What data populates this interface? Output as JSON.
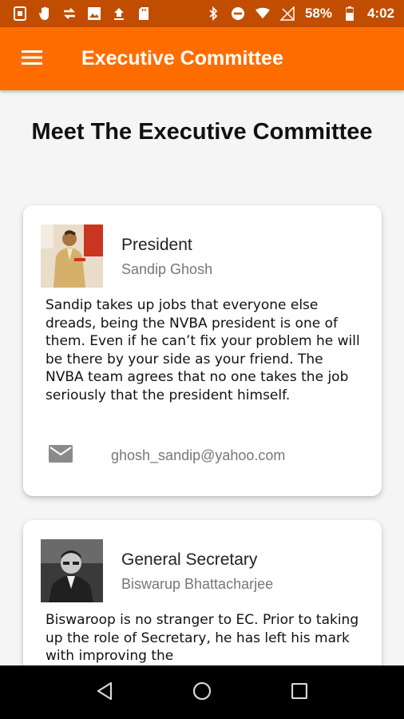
{
  "status_bar": {
    "battery_percent": "58%",
    "time": "4:02",
    "icons": [
      "phone-sync-icon",
      "hand-icon",
      "transfer-icon",
      "image-icon",
      "upload-icon",
      "sd-card-icon",
      "bluetooth-icon",
      "do-not-disturb-icon",
      "wifi-icon",
      "no-signal-icon",
      "battery-icon"
    ]
  },
  "app_bar": {
    "title": "Executive Committee",
    "menu_icon": "hamburger-menu-icon",
    "color": "#ff6d00"
  },
  "page": {
    "heading": "Meet The Executive Committee"
  },
  "members": [
    {
      "role": "President",
      "name": "Sandip Ghosh",
      "bio": "Sandip takes up jobs that everyone else dreads, being the NVBA president is one of them. Even if he can’t fix your problem he will be there by your side as your friend. The NVBA team agrees that no one takes the job seriously that the president himself.",
      "email": "ghosh_sandip@yahoo.com"
    },
    {
      "role": "General Secretary",
      "name": "Biswarup Bhattacharjee",
      "bio": "Biswaroop is no stranger to EC. Prior to taking up the role of Secretary, he has left his mark with improving the"
    }
  ],
  "nav_bar": {
    "icons": [
      "back-icon",
      "home-icon",
      "recents-icon"
    ]
  }
}
